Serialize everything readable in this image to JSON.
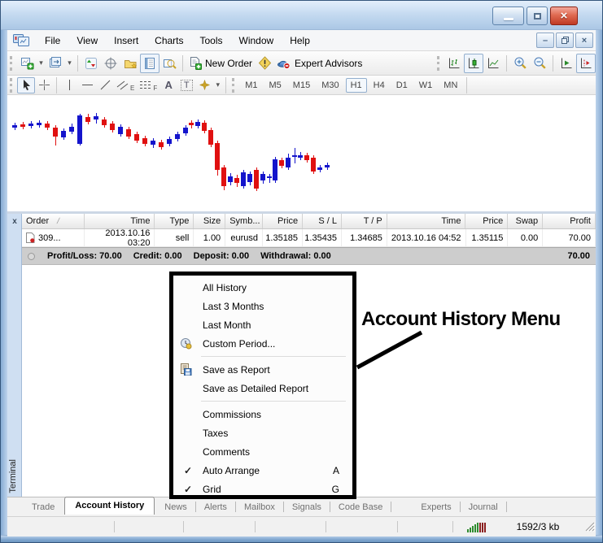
{
  "menu_bar": {
    "items": [
      "File",
      "View",
      "Insert",
      "Charts",
      "Tools",
      "Window",
      "Help"
    ]
  },
  "toolbar": {
    "new_order": "New Order",
    "expert_advisors": "Expert Advisors"
  },
  "timeframes": {
    "labels": [
      "M1",
      "M5",
      "M15",
      "M30",
      "H1",
      "H4",
      "D1",
      "W1",
      "MN"
    ],
    "active": "H1"
  },
  "chart_data": {
    "type": "candlestick",
    "symbol_timeframe_visible": false,
    "axes_visible": false,
    "up_color": "#1414cc",
    "down_color": "#e01010",
    "note": "pixel-estimated candles [x, body_top, body_bottom, wick_top, wick_bottom, direction] relative to chart area; no axis labels are visible in the screenshot",
    "candles": [
      [
        6,
        37,
        40,
        34,
        43,
        "u"
      ],
      [
        16,
        36,
        39,
        33,
        42,
        "d"
      ],
      [
        26,
        35,
        38,
        32,
        41,
        "u"
      ],
      [
        36,
        34,
        37,
        31,
        40,
        "u"
      ],
      [
        46,
        35,
        40,
        32,
        43,
        "d"
      ],
      [
        56,
        40,
        51,
        37,
        62,
        "d"
      ],
      [
        66,
        44,
        52,
        41,
        55,
        "u"
      ],
      [
        76,
        39,
        45,
        35,
        48,
        "u"
      ],
      [
        86,
        25,
        60,
        23,
        62,
        "u"
      ],
      [
        96,
        27,
        33,
        23,
        36,
        "d"
      ],
      [
        106,
        26,
        30,
        22,
        35,
        "u"
      ],
      [
        116,
        30,
        37,
        27,
        40,
        "d"
      ],
      [
        126,
        35,
        43,
        32,
        46,
        "d"
      ],
      [
        136,
        39,
        48,
        36,
        51,
        "u"
      ],
      [
        146,
        42,
        51,
        39,
        54,
        "d"
      ],
      [
        156,
        48,
        56,
        45,
        59,
        "d"
      ],
      [
        166,
        53,
        60,
        50,
        63,
        "d"
      ],
      [
        176,
        56,
        61,
        53,
        65,
        "u"
      ],
      [
        186,
        58,
        64,
        55,
        67,
        "d"
      ],
      [
        196,
        54,
        60,
        51,
        63,
        "u"
      ],
      [
        206,
        48,
        54,
        45,
        57,
        "u"
      ],
      [
        216,
        40,
        47,
        37,
        50,
        "u"
      ],
      [
        223,
        34,
        37,
        31,
        41,
        "d"
      ],
      [
        231,
        33,
        38,
        30,
        41,
        "u"
      ],
      [
        239,
        34,
        44,
        31,
        47,
        "d"
      ],
      [
        247,
        43,
        61,
        40,
        64,
        "d"
      ],
      [
        255,
        59,
        92,
        56,
        99,
        "d"
      ],
      [
        263,
        89,
        112,
        86,
        117,
        "d"
      ],
      [
        271,
        100,
        107,
        96,
        111,
        "u"
      ],
      [
        279,
        102,
        108,
        98,
        113,
        "d"
      ],
      [
        287,
        95,
        112,
        92,
        115,
        "u"
      ],
      [
        295,
        97,
        107,
        94,
        111,
        "u"
      ],
      [
        303,
        92,
        115,
        89,
        118,
        "d"
      ],
      [
        311,
        97,
        105,
        94,
        109,
        "u"
      ],
      [
        319,
        100,
        102,
        97,
        108,
        "u"
      ],
      [
        326,
        79,
        105,
        76,
        108,
        "u"
      ],
      [
        334,
        80,
        87,
        77,
        90,
        "d"
      ],
      [
        342,
        77,
        89,
        72,
        92,
        "u"
      ],
      [
        350,
        74,
        76,
        65,
        84,
        "u"
      ],
      [
        357,
        74,
        77,
        70,
        80,
        "u"
      ],
      [
        365,
        74,
        80,
        71,
        83,
        "d"
      ],
      [
        373,
        77,
        94,
        74,
        97,
        "d"
      ],
      [
        381,
        89,
        92,
        86,
        95,
        "u"
      ],
      [
        390,
        86,
        89,
        83,
        92,
        "u"
      ]
    ]
  },
  "terminal": {
    "close_label": "x",
    "side_label": "Terminal",
    "sort_indicator": "/",
    "columns": [
      "Order",
      "Time",
      "Type",
      "Size",
      "Symb...",
      "Price",
      "S / L",
      "T / P",
      "Time",
      "Price",
      "Swap",
      "Profit"
    ],
    "row": [
      "309...",
      "2013.10.16 03:20",
      "sell",
      "1.00",
      "eurusd",
      "1.35185",
      "1.35435",
      "1.34685",
      "2013.10.16 04:52",
      "1.35115",
      "0.00",
      "70.00"
    ],
    "summary": {
      "parts": [
        "Profit/Loss: 70.00",
        "Credit: 0.00",
        "Deposit: 0.00",
        "Withdrawal: 0.00"
      ],
      "total": "70.00"
    }
  },
  "context_menu": {
    "items": [
      {
        "label": "All History"
      },
      {
        "label": "Last 3 Months"
      },
      {
        "label": "Last Month"
      },
      {
        "label": "Custom Period...",
        "icon": "clock-icon"
      },
      {
        "label": "Save as Report",
        "icon": "save-report-icon"
      },
      {
        "label": "Save as Detailed Report"
      },
      {
        "label": "Commissions"
      },
      {
        "label": "Taxes"
      },
      {
        "label": "Comments"
      },
      {
        "label": "Auto Arrange",
        "checked": true,
        "shortcut": "A"
      },
      {
        "label": "Grid",
        "checked": true,
        "shortcut": "G"
      }
    ],
    "checkmark": "✓"
  },
  "annotation": {
    "label": "Account History Menu"
  },
  "tab_bar": {
    "tabs": [
      "Trade",
      "Account History",
      "News",
      "Alerts",
      "Mailbox",
      "Signals",
      "Code Base",
      "Experts",
      "Journal"
    ],
    "active": "Account History"
  },
  "status_bar": {
    "traffic": "1592/3 kb"
  }
}
